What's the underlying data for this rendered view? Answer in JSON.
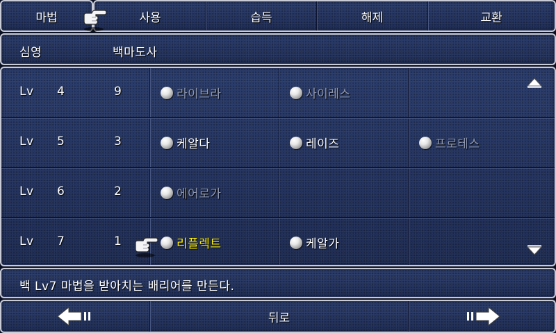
{
  "tabs": {
    "magic": "마법",
    "use": "사용",
    "learn": "습득",
    "remove": "해제",
    "trade": "교환"
  },
  "character": {
    "name": "심영",
    "job": "백마도사"
  },
  "spell_rows": [
    {
      "lv_label": "Lv",
      "level": "4",
      "charges": "9",
      "spells": [
        {
          "name": "라이브라",
          "state": "dim"
        },
        {
          "name": "사이레스",
          "state": "dim"
        }
      ]
    },
    {
      "lv_label": "Lv",
      "level": "5",
      "charges": "3",
      "spells": [
        {
          "name": "케알다",
          "state": "normal"
        },
        {
          "name": "레이즈",
          "state": "normal"
        },
        {
          "name": "프로테스",
          "state": "dim"
        }
      ]
    },
    {
      "lv_label": "Lv",
      "level": "6",
      "charges": "2",
      "spells": [
        {
          "name": "에어로가",
          "state": "dim"
        }
      ]
    },
    {
      "lv_label": "Lv",
      "level": "7",
      "charges": "1",
      "spells": [
        {
          "name": "리플렉트",
          "state": "selected"
        },
        {
          "name": "케알가",
          "state": "normal"
        }
      ]
    }
  ],
  "description": "백 Lv7 마법을 받아치는 배리어를 만든다.",
  "nav": {
    "back": "뒤로"
  },
  "icons": {
    "cursor": "pointing-hand-icon",
    "orb": "spell-orb-icon",
    "scroll_up": "scroll-up-arrow-icon",
    "scroll_down": "scroll-down-arrow-icon",
    "prev": "prev-page-arrow-icon",
    "next": "next-page-arrow-icon"
  },
  "colors": {
    "panel": "#1f2f5a",
    "border": "#c9ccd6",
    "selected_text": "#fff10a",
    "dim_text": "#8f97ad"
  }
}
